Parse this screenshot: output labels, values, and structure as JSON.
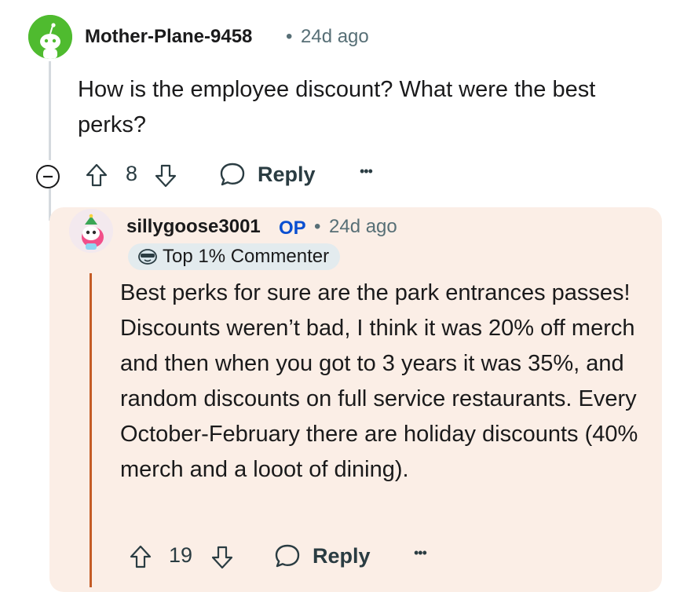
{
  "comment1": {
    "username": "Mother-Plane-9458",
    "separator": "•",
    "age": "24d ago",
    "body": "How is the employee discount? What were the best perks?",
    "actions": {
      "score": "8",
      "reply_label": "Reply",
      "more_label": "•••"
    }
  },
  "comment2": {
    "username": "sillygoose3001",
    "op_label": "OP",
    "separator": "•",
    "age": "24d ago",
    "badge_label": "Top 1% Commenter",
    "body": "Best perks for sure are the park entrances passes! Discounts weren’t bad, I think it was 20% off merch and then when you got to 3 years it was 35%, and random discounts on full service restaurants. Every October-February there are holiday discounts (40% merch and a looot of dining).",
    "actions": {
      "score": "19",
      "reply_label": "Reply",
      "more_label": "•••"
    }
  },
  "colors": {
    "op_blue": "#0a4fd1",
    "highlight_bg": "#fbeee6",
    "avatar1_bg": "#4fbb2f",
    "thread_line": "#d5dadf",
    "accent_line": "#c45c26"
  },
  "icons": [
    "collapse-icon",
    "upvote-icon",
    "downvote-icon",
    "reply-bubble-icon",
    "more-options-icon",
    "commenter-badge-icon"
  ]
}
